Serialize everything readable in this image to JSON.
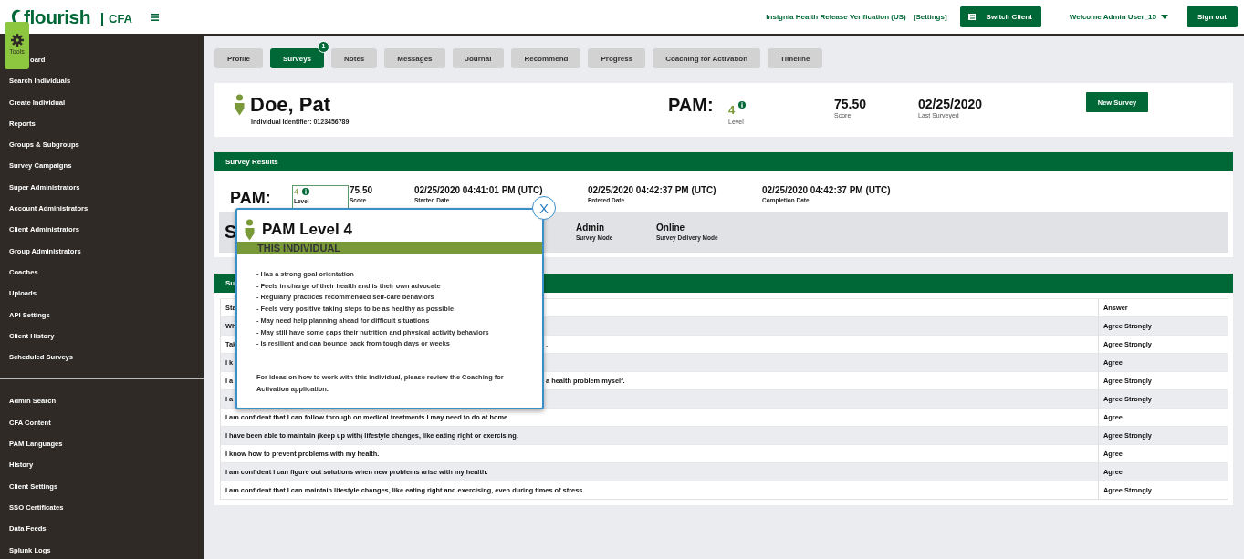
{
  "header": {
    "logo_text": "flourish",
    "product": "CFA",
    "org_name": "Insignia Health Release Verification (US)",
    "settings_link": "[Settings]",
    "switch_client": "Switch Client",
    "welcome": "Welcome Admin User_15",
    "sign_out": "Sign out"
  },
  "tools": {
    "label": "Tools"
  },
  "sidebar": {
    "items": [
      "oard",
      "Search Individuals",
      "Create Individual",
      "Reports",
      "Groups & Subgroups",
      "Survey Campaigns",
      "Super Administrators",
      "Account Administrators",
      "Client Administrators",
      "Group Administrators",
      "Coaches",
      "Uploads",
      "API Settings",
      "Client History",
      "Scheduled Surveys"
    ],
    "admin_items": [
      "Admin Search",
      "CFA Content",
      "PAM Languages",
      "History",
      "Client Settings",
      "SSO Certificates",
      "Data Feeds",
      "Splunk Logs"
    ]
  },
  "tabs": [
    {
      "label": "Profile",
      "selected": false
    },
    {
      "label": "Surveys",
      "selected": true,
      "badge": "1"
    },
    {
      "label": "Notes",
      "selected": false
    },
    {
      "label": "Messages",
      "selected": false
    },
    {
      "label": "Journal",
      "selected": false
    },
    {
      "label": "Recommend",
      "selected": false
    },
    {
      "label": "Progress",
      "selected": false
    },
    {
      "label": "Coaching for Activation",
      "selected": false
    },
    {
      "label": "Timeline",
      "selected": false
    }
  ],
  "profile": {
    "name": "Doe, Pat",
    "identifier": "Individual Identifier: 0123456789",
    "pam_label": "PAM:",
    "level": "4",
    "level_caption": "Level",
    "score": "75.50",
    "score_caption": "Score",
    "last_surveyed": "02/25/2020",
    "last_surveyed_caption": "Last Surveyed",
    "new_survey": "New Survey"
  },
  "survey_results": {
    "title": "Survey Results",
    "pam_label": "PAM:",
    "level": "4",
    "level_caption": "Level",
    "fields": [
      {
        "value": "75.50",
        "caption": "Score"
      },
      {
        "value": "02/25/2020 04:41:01 PM (UTC)",
        "caption": "Started Date"
      },
      {
        "value": "02/25/2020 04:42:37 PM (UTC)",
        "caption": "Entered Date"
      },
      {
        "value": "02/25/2020 04:42:37 PM (UTC)",
        "caption": "Completion Date"
      }
    ],
    "mode_section_title": "S",
    "modes": [
      {
        "value": "Admin",
        "caption": "Survey Mode"
      },
      {
        "value": "Online",
        "caption": "Survey Delivery Mode"
      }
    ]
  },
  "questions": {
    "title": "Su",
    "columns": [
      "Sta",
      "Answer"
    ],
    "rows": [
      {
        "question": "Wh",
        "answer": "Agree Strongly"
      },
      {
        "question": "Tak",
        "question_tail": ".",
        "answer": "Agree Strongly"
      },
      {
        "question": "I k",
        "answer": "Agree"
      },
      {
        "question": "I a",
        "question_tail": "a health problem myself.",
        "answer": "Agree Strongly"
      },
      {
        "question": "I a",
        "answer": "Agree Strongly"
      },
      {
        "question": "I am confident that I can follow through on medical treatments I may need to do at home.",
        "answer": "Agree"
      },
      {
        "question": "I have been able to maintain (keep up with) lifestyle changes, like eating right or exercising.",
        "answer": "Agree Strongly"
      },
      {
        "question": "I know how to prevent problems with my health.",
        "answer": "Agree"
      },
      {
        "question": "I am confident I can figure out solutions when new problems arise with my health.",
        "answer": "Agree"
      },
      {
        "question": "I am confident that I can maintain lifestyle changes, like eating right and exercising, even during times of stress.",
        "answer": "Agree Strongly"
      }
    ]
  },
  "popup": {
    "title": "PAM Level 4",
    "subtitle": "THIS INDIVIDUAL",
    "close": "X",
    "bullets": [
      "- Has a strong goal orientation",
      "- Feels in charge of their health and is their own advocate",
      "- Regularly practices recommended self-care behaviors",
      "- Feels very positive taking steps to be as healthy as possible",
      "- May need help planning ahead for difficult situations",
      "- May still have some gaps their nutrition and physical activity behaviors",
      "- Is resilient and can bounce back from tough days or weeks"
    ],
    "note": "For ideas on how to work with this individual, please review the Coaching for Activation application."
  }
}
